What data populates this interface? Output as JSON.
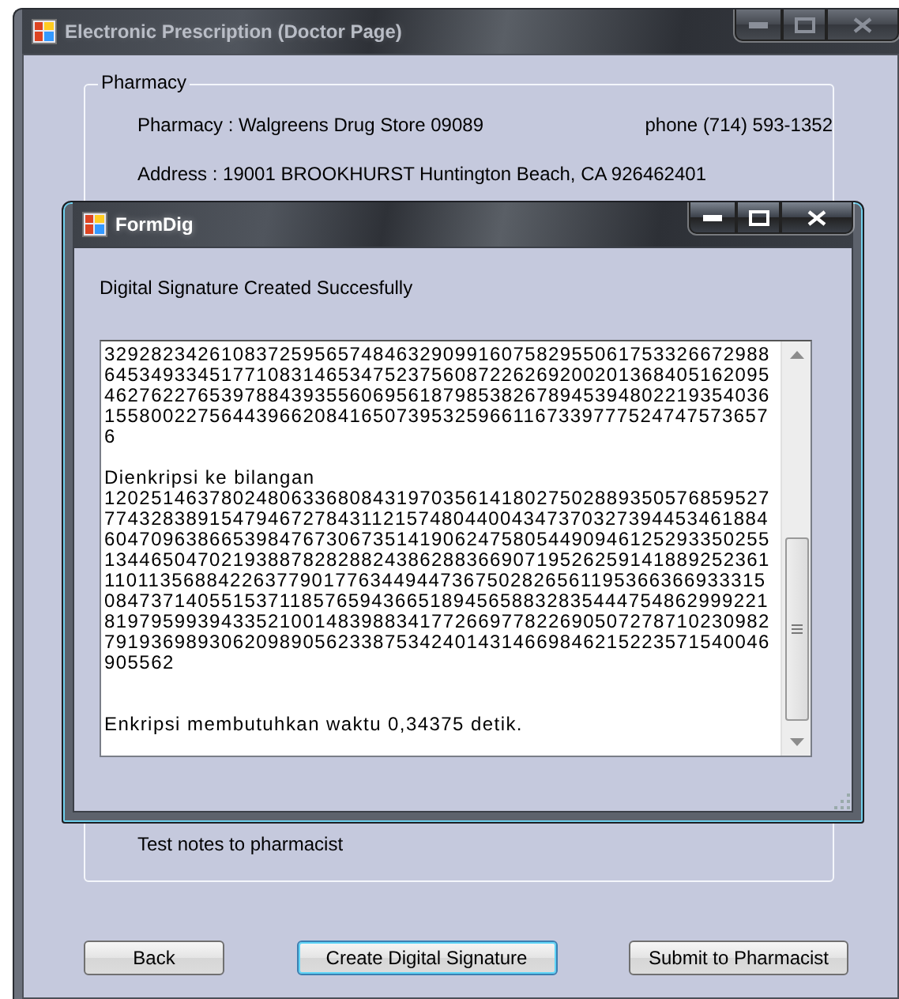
{
  "main_window": {
    "title": "Electronic Prescription (Doctor Page)",
    "active": false
  },
  "pharmacy_group": {
    "label": "Pharmacy",
    "pharmacy": "Pharmacy : Walgreens Drug Store 09089",
    "phone": "phone (714) 593-1352",
    "address": "Address : 19001 BROOKHURST Huntington Beach, CA 926462401"
  },
  "notes": "Test notes to pharmacist",
  "buttons": [
    {
      "label": "Back",
      "focused": false
    },
    {
      "label": "Create Digital Signature",
      "focused": true
    },
    {
      "label": "Submit to Pharmacist",
      "focused": false
    }
  ],
  "dialog": {
    "title": "FormDig",
    "active": true,
    "message": "Digital Signature Created Succesfully",
    "output": [
      {
        "kind": "text",
        "text": "329282342610837259565748463290991607582955061753326672988"
      },
      {
        "kind": "text",
        "text": "645349334517710831465347523756087226269200201368405162095"
      },
      {
        "kind": "text",
        "text": "462762276539788439355606956187985382678945394802219354036"
      },
      {
        "kind": "text",
        "text": "155800227564439662084165073953259661167339777524747573657"
      },
      {
        "kind": "text",
        "text": "6"
      },
      {
        "kind": "blank"
      },
      {
        "kind": "text",
        "text": "Dienkripsi ke bilangan"
      },
      {
        "kind": "text",
        "text": "120251463780248063368084319703561418027502889350576859527"
      },
      {
        "kind": "text",
        "text": "774328389154794672784311215748044004347370327394453461884"
      },
      {
        "kind": "text",
        "text": "604709638665398476730673514190624758054490946125293350255"
      },
      {
        "kind": "text",
        "text": "134465047021938878282882438628836690719526259141889252361"
      },
      {
        "kind": "text",
        "text": "110113568842263779017763449447367502826561195366366933315"
      },
      {
        "kind": "text",
        "text": "084737140551537118576594366518945658832835444754862999221"
      },
      {
        "kind": "text",
        "text": "819795993943352100148398834177266977822690507278710230982"
      },
      {
        "kind": "text",
        "text": "791936989306209890562338753424014314669846215223571540046"
      },
      {
        "kind": "text",
        "text": "905562"
      },
      {
        "kind": "blank"
      },
      {
        "kind": "blank"
      },
      {
        "kind": "text",
        "text": "Enkripsi membutuhkan waktu 0,34375 detik."
      }
    ]
  }
}
